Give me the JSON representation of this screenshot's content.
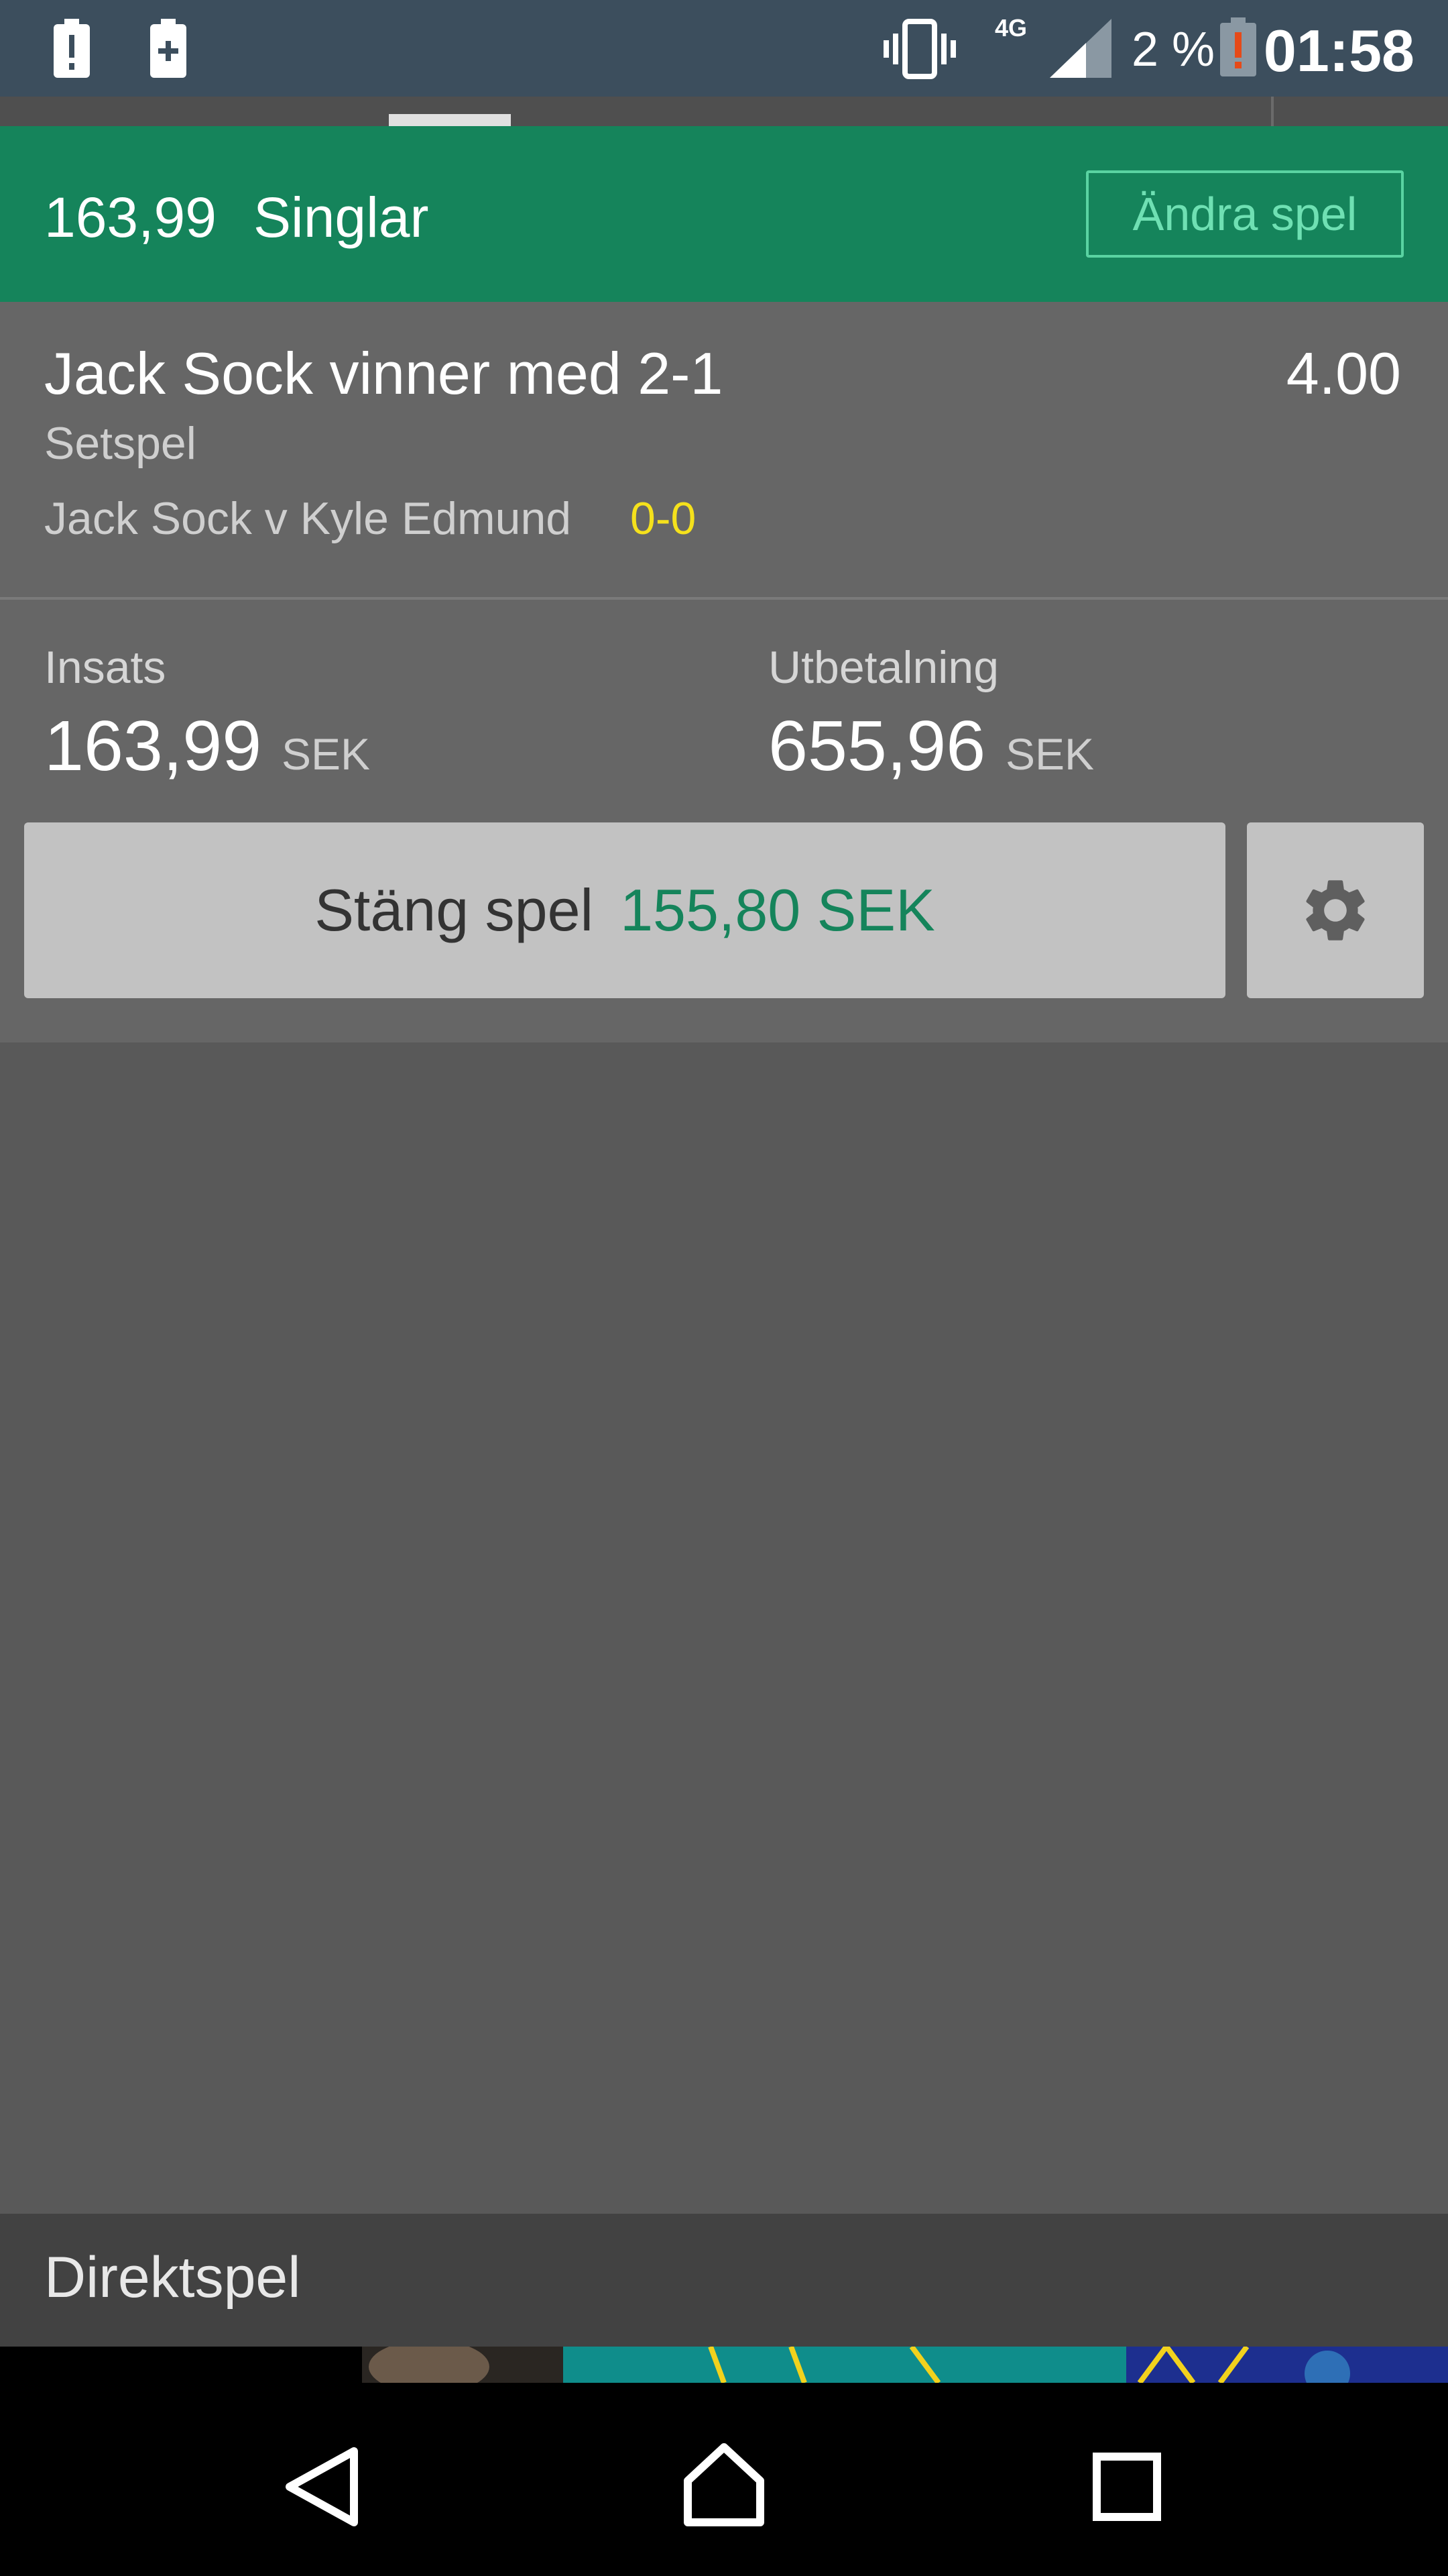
{
  "status_bar": {
    "network": "4G",
    "battery_percent": "2 %",
    "time": "01:58"
  },
  "header": {
    "stake": "163,99",
    "bet_type": "Singlar",
    "edit_button": "Ändra spel"
  },
  "bet": {
    "selection": "Jack Sock vinner med 2-1",
    "odds": "4.00",
    "market": "Setspel",
    "event": "Jack Sock v Kyle Edmund",
    "score": "0-0",
    "stake_label": "Insats",
    "stake_amount": "163,99",
    "stake_currency": "SEK",
    "payout_label": "Utbetalning",
    "payout_amount": "655,96",
    "payout_currency": "SEK",
    "cashout_label": "Stäng spel",
    "cashout_amount": "155,80 SEK"
  },
  "live_section": {
    "title": "Direktspel"
  },
  "colors": {
    "status_bar": "#3c4e5d",
    "header_green": "#15845b",
    "cashout_green": "#15845b",
    "score_yellow": "#f5e11c"
  },
  "icons": {
    "status_left": [
      "alert-icon",
      "battery-plus-icon"
    ],
    "status_right": [
      "vibrate-icon",
      "signal-icon",
      "battery-low-icon"
    ],
    "settings": "gear-icon",
    "nav": [
      "back-icon",
      "home-icon",
      "recents-icon"
    ]
  }
}
